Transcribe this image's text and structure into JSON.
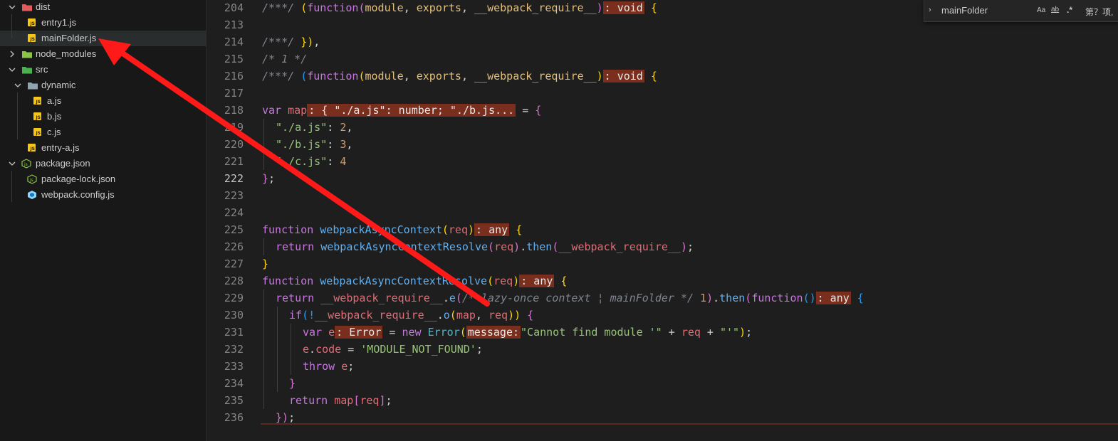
{
  "explorer": {
    "items": [
      {
        "label": "dist",
        "kind": "folder-open",
        "depth": 0,
        "chev": "down",
        "color": "#e05c5c"
      },
      {
        "label": "entry1.js",
        "kind": "js",
        "depth": 1
      },
      {
        "label": "mainFolder.js",
        "kind": "js",
        "depth": 1,
        "selected": true
      },
      {
        "label": "node_modules",
        "kind": "folder",
        "depth": 0,
        "chev": "right",
        "color": "#8bc34a"
      },
      {
        "label": "src",
        "kind": "folder-open",
        "depth": 0,
        "chev": "down",
        "color": "#4caf50"
      },
      {
        "label": "dynamic",
        "kind": "folder-open",
        "depth": 1,
        "chev": "down",
        "color": "#90a4ae"
      },
      {
        "label": "a.js",
        "kind": "js",
        "depth": 2
      },
      {
        "label": "b.js",
        "kind": "js",
        "depth": 2
      },
      {
        "label": "c.js",
        "kind": "js",
        "depth": 2
      },
      {
        "label": "entry-a.js",
        "kind": "js",
        "depth": 1
      },
      {
        "label": "package.json",
        "kind": "npm",
        "depth": 0,
        "chev": "down"
      },
      {
        "label": "package-lock.json",
        "kind": "npm",
        "depth": 1
      },
      {
        "label": "webpack.config.js",
        "kind": "webpack",
        "depth": 1
      }
    ]
  },
  "find": {
    "query": "mainFolder",
    "case_label": "Aa",
    "word_label": "ab",
    "regex_label": ".*",
    "result_label": "第？项,"
  },
  "editor": {
    "active_line": "222",
    "lines": [
      {
        "n": "204"
      },
      {
        "n": "213"
      },
      {
        "n": "214"
      },
      {
        "n": "215"
      },
      {
        "n": "216"
      },
      {
        "n": "217"
      },
      {
        "n": "218"
      },
      {
        "n": "219"
      },
      {
        "n": "220"
      },
      {
        "n": "221"
      },
      {
        "n": "222"
      },
      {
        "n": "223"
      },
      {
        "n": "224"
      },
      {
        "n": "225"
      },
      {
        "n": "226"
      },
      {
        "n": "227"
      },
      {
        "n": "228"
      },
      {
        "n": "229"
      },
      {
        "n": "230"
      },
      {
        "n": "231"
      },
      {
        "n": "232"
      },
      {
        "n": "233"
      },
      {
        "n": "234"
      },
      {
        "n": "235"
      },
      {
        "n": "236"
      }
    ],
    "tokens": {
      "l204": [
        "/***/ ",
        "(",
        "function",
        "(",
        "module",
        ", ",
        "exports",
        ", ",
        "__webpack_require__",
        ")",
        ": void",
        " {"
      ],
      "l214": [
        "/***/ ",
        "})",
        ","
      ],
      "l215": [
        "/* 1 */"
      ],
      "l216": [
        "/***/ ",
        "(",
        "function",
        "(",
        "module",
        ", ",
        "exports",
        ", ",
        "__webpack_require__",
        ")",
        ": void",
        " ",
        "{"
      ],
      "l218": [
        "var ",
        "map",
        ": { \"./a.js\": number; \"./b.js...",
        "",
        " = ",
        "{"
      ],
      "l219": [
        "\"./a.js\"",
        ": ",
        "2",
        ","
      ],
      "l220": [
        "\"./b.js\"",
        ": ",
        "3",
        ","
      ],
      "l221": [
        "\"./c.js\"",
        ": ",
        "4"
      ],
      "l222": [
        "}",
        ";"
      ],
      "l225": [
        "function ",
        "webpackAsyncContext",
        "(",
        "req",
        ")",
        ": any",
        " {"
      ],
      "l226": [
        "return ",
        "webpackAsyncContextResolve",
        "(",
        "req",
        ")",
        ".",
        "then",
        "(",
        "__webpack_require__",
        ")",
        ";"
      ],
      "l227": [
        "}"
      ],
      "l228": [
        "function ",
        "webpackAsyncContextResolve",
        "(",
        "req",
        ")",
        ": any",
        " {"
      ],
      "l229": [
        "return ",
        "__webpack_require__",
        ".",
        "e",
        "(",
        "/* lazy-once context ",
        "¦",
        " mainFolder",
        " */",
        " 1",
        ")",
        ".",
        "then",
        "(",
        "function",
        "()",
        ": any",
        " {"
      ],
      "l230": [
        "if",
        "(!",
        "__webpack_require__",
        ".",
        "o",
        "(",
        "map",
        ", ",
        "req",
        "))",
        " {"
      ],
      "l231": [
        "var ",
        "e",
        ": Error",
        " = ",
        "new ",
        "Error",
        "(",
        "message:",
        "\"Cannot find module '\"",
        " + ",
        "req",
        " + ",
        "\"'\"",
        ")",
        ";"
      ],
      "l232": [
        "e",
        ".",
        "code",
        " = ",
        "'MODULE_NOT_FOUND'",
        ";"
      ],
      "l233": [
        "throw ",
        "e",
        ";"
      ],
      "l234": [
        "}"
      ],
      "l235": [
        "return ",
        "map",
        "[",
        "req",
        "]",
        ";"
      ],
      "l236": [
        "})",
        ";"
      ]
    }
  },
  "colors": {
    "annotation_arrow": "#ff1a1a",
    "hint_bg": "#7a2e1d",
    "selected_row": "#2a2d2e"
  },
  "icons": [
    "chevron-down-icon",
    "chevron-right-icon",
    "folder-icon",
    "js-file-icon",
    "npm-file-icon",
    "webpack-file-icon",
    "case-sensitive-icon",
    "whole-word-icon",
    "regex-icon"
  ]
}
